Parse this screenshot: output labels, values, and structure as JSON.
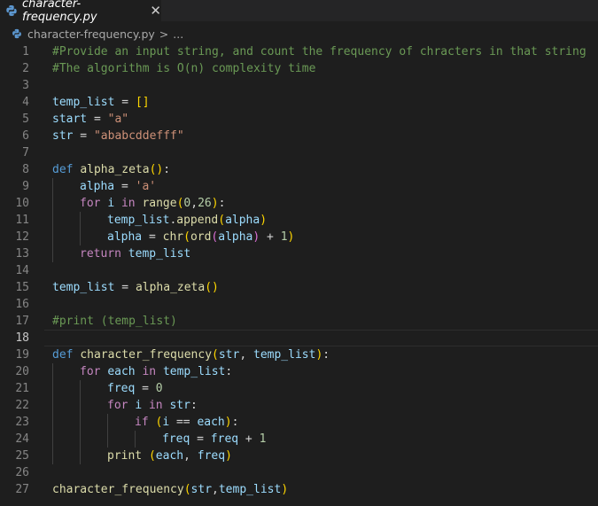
{
  "tab": {
    "label": "character-frequency.py",
    "close_glyph": "✕"
  },
  "breadcrumb": {
    "file": "character-frequency.py",
    "separator": ">",
    "more": "..."
  },
  "editor": {
    "current_line": 18,
    "lines": [
      {
        "n": "1",
        "tokens": [
          {
            "t": "#Provide an input string, and count the frequency of chracters in that string",
            "c": "comment"
          }
        ]
      },
      {
        "n": "2",
        "tokens": [
          {
            "t": "#The algorithm is O(n) complexity time",
            "c": "comment"
          }
        ]
      },
      {
        "n": "3",
        "tokens": []
      },
      {
        "n": "4",
        "tokens": [
          {
            "t": "temp_list",
            "c": "var"
          },
          {
            "t": " = ",
            "c": "op"
          },
          {
            "t": "[]",
            "c": "b1"
          }
        ]
      },
      {
        "n": "5",
        "tokens": [
          {
            "t": "start",
            "c": "var"
          },
          {
            "t": " = ",
            "c": "op"
          },
          {
            "t": "\"a\"",
            "c": "str"
          }
        ]
      },
      {
        "n": "6",
        "tokens": [
          {
            "t": "str",
            "c": "var"
          },
          {
            "t": " = ",
            "c": "op"
          },
          {
            "t": "\"ababcddefff\"",
            "c": "str"
          }
        ]
      },
      {
        "n": "7",
        "tokens": []
      },
      {
        "n": "8",
        "tokens": [
          {
            "t": "def",
            "c": "kw"
          },
          {
            "t": " ",
            "c": "plain"
          },
          {
            "t": "alpha_zeta",
            "c": "fn"
          },
          {
            "t": "()",
            "c": "b1"
          },
          {
            "t": ":",
            "c": "plain"
          }
        ]
      },
      {
        "n": "9",
        "indent": 1,
        "tokens": [
          {
            "t": "alpha",
            "c": "var"
          },
          {
            "t": " = ",
            "c": "op"
          },
          {
            "t": "'a'",
            "c": "str"
          }
        ]
      },
      {
        "n": "10",
        "indent": 1,
        "tokens": [
          {
            "t": "for",
            "c": "ctl"
          },
          {
            "t": " ",
            "c": "plain"
          },
          {
            "t": "i",
            "c": "var"
          },
          {
            "t": " ",
            "c": "plain"
          },
          {
            "t": "in",
            "c": "ctl"
          },
          {
            "t": " ",
            "c": "plain"
          },
          {
            "t": "range",
            "c": "fn"
          },
          {
            "t": "(",
            "c": "b1"
          },
          {
            "t": "0",
            "c": "num"
          },
          {
            "t": ",",
            "c": "plain"
          },
          {
            "t": "26",
            "c": "num"
          },
          {
            "t": ")",
            "c": "b1"
          },
          {
            "t": ":",
            "c": "plain"
          }
        ]
      },
      {
        "n": "11",
        "indent": 2,
        "tokens": [
          {
            "t": "temp_list",
            "c": "var"
          },
          {
            "t": ".",
            "c": "plain"
          },
          {
            "t": "append",
            "c": "fn"
          },
          {
            "t": "(",
            "c": "b1"
          },
          {
            "t": "alpha",
            "c": "var"
          },
          {
            "t": ")",
            "c": "b1"
          }
        ]
      },
      {
        "n": "12",
        "indent": 2,
        "tokens": [
          {
            "t": "alpha",
            "c": "var"
          },
          {
            "t": " = ",
            "c": "op"
          },
          {
            "t": "chr",
            "c": "fn"
          },
          {
            "t": "(",
            "c": "b1"
          },
          {
            "t": "ord",
            "c": "fn"
          },
          {
            "t": "(",
            "c": "b2"
          },
          {
            "t": "alpha",
            "c": "var"
          },
          {
            "t": ")",
            "c": "b2"
          },
          {
            "t": " + ",
            "c": "op"
          },
          {
            "t": "1",
            "c": "num"
          },
          {
            "t": ")",
            "c": "b1"
          }
        ]
      },
      {
        "n": "13",
        "indent": 1,
        "tokens": [
          {
            "t": "return",
            "c": "ctl"
          },
          {
            "t": " ",
            "c": "plain"
          },
          {
            "t": "temp_list",
            "c": "var"
          }
        ]
      },
      {
        "n": "14",
        "tokens": []
      },
      {
        "n": "15",
        "tokens": [
          {
            "t": "temp_list",
            "c": "var"
          },
          {
            "t": " = ",
            "c": "op"
          },
          {
            "t": "alpha_zeta",
            "c": "fn"
          },
          {
            "t": "()",
            "c": "b1"
          }
        ]
      },
      {
        "n": "16",
        "tokens": []
      },
      {
        "n": "17",
        "tokens": [
          {
            "t": "#print (temp_list)",
            "c": "comment"
          }
        ]
      },
      {
        "n": "18",
        "tokens": []
      },
      {
        "n": "19",
        "tokens": [
          {
            "t": "def",
            "c": "kw"
          },
          {
            "t": " ",
            "c": "plain"
          },
          {
            "t": "character_frequency",
            "c": "fn"
          },
          {
            "t": "(",
            "c": "b1"
          },
          {
            "t": "str",
            "c": "var"
          },
          {
            "t": ", ",
            "c": "plain"
          },
          {
            "t": "temp_list",
            "c": "var"
          },
          {
            "t": ")",
            "c": "b1"
          },
          {
            "t": ":",
            "c": "plain"
          }
        ]
      },
      {
        "n": "20",
        "indent": 1,
        "tokens": [
          {
            "t": "for",
            "c": "ctl"
          },
          {
            "t": " ",
            "c": "plain"
          },
          {
            "t": "each",
            "c": "var"
          },
          {
            "t": " ",
            "c": "plain"
          },
          {
            "t": "in",
            "c": "ctl"
          },
          {
            "t": " ",
            "c": "plain"
          },
          {
            "t": "temp_list",
            "c": "var"
          },
          {
            "t": ":",
            "c": "plain"
          }
        ]
      },
      {
        "n": "21",
        "indent": 2,
        "tokens": [
          {
            "t": "freq",
            "c": "var"
          },
          {
            "t": " = ",
            "c": "op"
          },
          {
            "t": "0",
            "c": "num"
          }
        ]
      },
      {
        "n": "22",
        "indent": 2,
        "tokens": [
          {
            "t": "for",
            "c": "ctl"
          },
          {
            "t": " ",
            "c": "plain"
          },
          {
            "t": "i",
            "c": "var"
          },
          {
            "t": " ",
            "c": "plain"
          },
          {
            "t": "in",
            "c": "ctl"
          },
          {
            "t": " ",
            "c": "plain"
          },
          {
            "t": "str",
            "c": "var"
          },
          {
            "t": ":",
            "c": "plain"
          }
        ]
      },
      {
        "n": "23",
        "indent": 3,
        "tokens": [
          {
            "t": "if",
            "c": "ctl"
          },
          {
            "t": " ",
            "c": "plain"
          },
          {
            "t": "(",
            "c": "b1"
          },
          {
            "t": "i",
            "c": "var"
          },
          {
            "t": " == ",
            "c": "op"
          },
          {
            "t": "each",
            "c": "var"
          },
          {
            "t": ")",
            "c": "b1"
          },
          {
            "t": ":",
            "c": "plain"
          }
        ]
      },
      {
        "n": "24",
        "indent": 4,
        "tokens": [
          {
            "t": "freq",
            "c": "var"
          },
          {
            "t": " = ",
            "c": "op"
          },
          {
            "t": "freq",
            "c": "var"
          },
          {
            "t": " + ",
            "c": "op"
          },
          {
            "t": "1",
            "c": "num"
          }
        ]
      },
      {
        "n": "25",
        "indent": 2,
        "tokens": [
          {
            "t": "print",
            "c": "fn"
          },
          {
            "t": " ",
            "c": "plain"
          },
          {
            "t": "(",
            "c": "b1"
          },
          {
            "t": "each",
            "c": "var"
          },
          {
            "t": ", ",
            "c": "plain"
          },
          {
            "t": "freq",
            "c": "var"
          },
          {
            "t": ")",
            "c": "b1"
          }
        ]
      },
      {
        "n": "26",
        "tokens": []
      },
      {
        "n": "27",
        "tokens": [
          {
            "t": "character_frequency",
            "c": "fn"
          },
          {
            "t": "(",
            "c": "b1"
          },
          {
            "t": "str",
            "c": "var"
          },
          {
            "t": ",",
            "c": "plain"
          },
          {
            "t": "temp_list",
            "c": "var"
          },
          {
            "t": ")",
            "c": "b1"
          }
        ]
      }
    ]
  }
}
